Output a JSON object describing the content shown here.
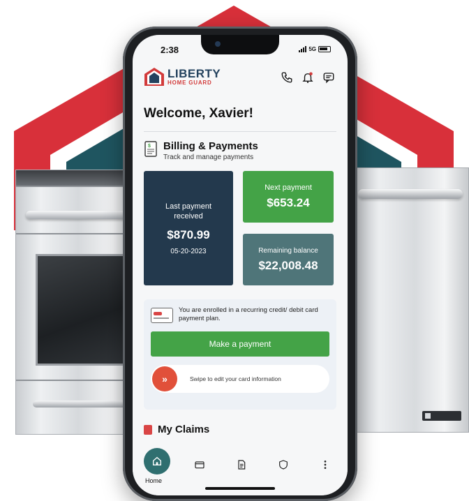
{
  "status_bar": {
    "time": "2:38",
    "network": "5G"
  },
  "brand": {
    "name": "LIBERTY",
    "tagline": "HOME GUARD",
    "primary_color": "#23425e",
    "accent_color": "#d23b3b"
  },
  "header": {
    "icons": [
      "phone-icon",
      "bell-icon",
      "chat-icon"
    ]
  },
  "welcome": {
    "text": "Welcome, Xavier!"
  },
  "billing": {
    "title": "Billing & Payments",
    "subtitle": "Track and manage payments",
    "last_payment": {
      "label": "Last payment received",
      "amount": "$870.99",
      "date": "05-20-2023"
    },
    "next_payment": {
      "label": "Next payment",
      "amount": "$653.24"
    },
    "remaining_balance": {
      "label": "Remaining balance",
      "amount": "$22,008.48"
    },
    "enrollment_text": "You are enrolled in a recurring credit/ debit card payment plan.",
    "pay_button": "Make a payment",
    "swipe_text": "Swipe to edit your card information"
  },
  "claims": {
    "title": "My Claims"
  },
  "bottom_nav": {
    "home_label": "Home",
    "items": [
      "home-icon",
      "card-icon",
      "document-icon",
      "shield-icon",
      "more-icon"
    ]
  },
  "colors": {
    "green": "#44a347",
    "navy": "#23394d",
    "teal": "#4f7579",
    "red": "#d23b3b"
  }
}
